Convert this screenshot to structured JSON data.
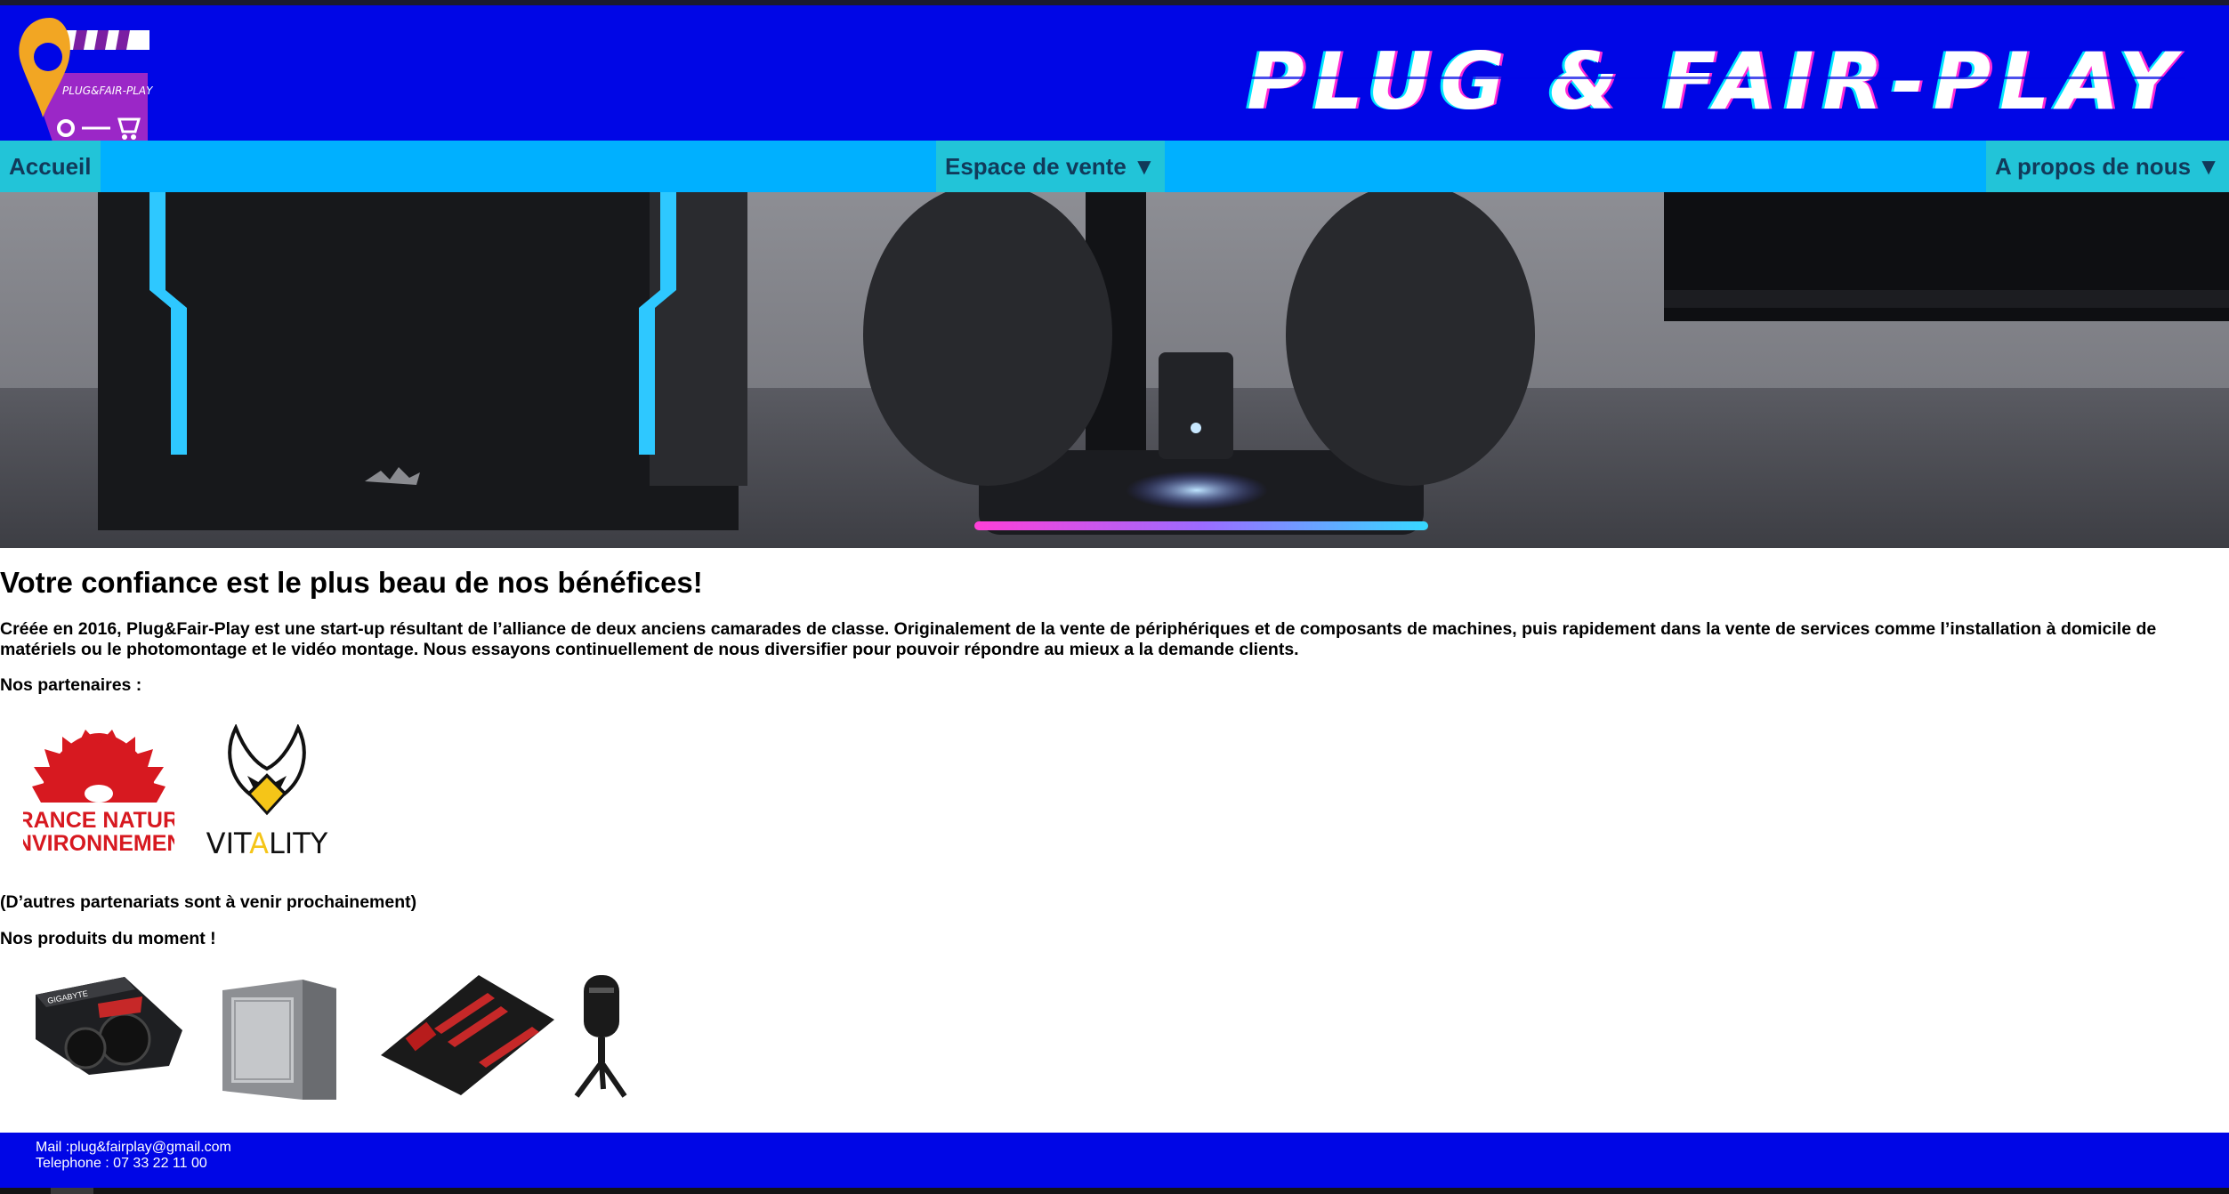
{
  "header": {
    "brand": "PLUG & FAIR-PLAY",
    "logo_text": "PLUG&FAIR-PLAY"
  },
  "nav": {
    "home": "Accueil",
    "shop": "Espace de vente ▼",
    "about": "A propos de nous ▼"
  },
  "main": {
    "title": "Votre confiance est le plus beau de nos bénéfices!",
    "intro": "Créée en 2016, Plug&Fair-Play est une start-up résultant de l’alliance de deux anciens camarades de classe. Originalement de la vente de périphériques et de composants de machines, puis rapidement dans la vente de services comme l’installation à domicile de matériels ou le photomontage et le vidéo montage. Nous essayons continuellement de nous diversifier pour pouvoir répondre au mieux a la demande clients.",
    "partners_label": "Nos partenaires :",
    "partners": [
      {
        "line1": "FRANCE NATURE",
        "line2": "ENVIRONNEMENT"
      },
      {
        "pre": "VIT",
        "accent": "A",
        "post": "LITY"
      }
    ],
    "partners_note": "(D’autres partenariats sont à venir prochainement)",
    "products_label": "Nos produits du moment !",
    "products_brand_gpu": "GIGABYTE"
  },
  "footer": {
    "mail": "Mail :plug&fairplay@gmail.com",
    "phone": "Telephone : 07 33 22 11 00"
  },
  "colors": {
    "header": "#0006e6",
    "nav": "#00b0ff",
    "nav_item": "#22c4d8",
    "vitality_accent": "#f5c518",
    "fne_red": "#d71920"
  }
}
